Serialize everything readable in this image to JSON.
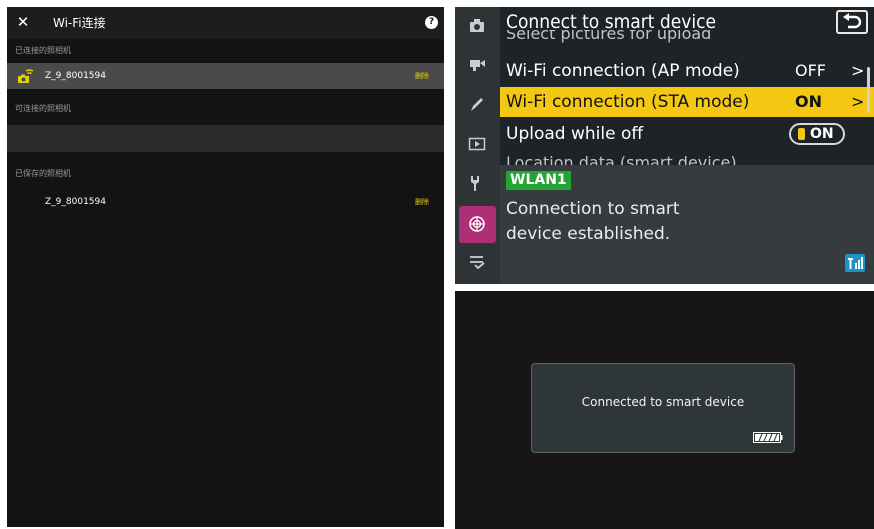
{
  "phone": {
    "close_icon": "close-icon",
    "title": "Wi-Fi连接",
    "help_icon": "help-icon",
    "section_connected": "已连接的照相机",
    "connected_camera": {
      "name": "Z_9_8001594",
      "delete_label": "删除",
      "icon": "camera-wifi-icon"
    },
    "section_available": "可连接的照相机",
    "section_saved": "已保存的照相机",
    "saved_camera": {
      "name": "Z_9_8001594",
      "delete_label": "删除"
    }
  },
  "camera_menu": {
    "title": "Connect to smart device",
    "partial_top": "Select pictures for upload",
    "items": [
      {
        "label": "Wi-Fi connection (AP mode)",
        "value": "OFF"
      },
      {
        "label": "Wi-Fi connection (STA mode)",
        "value": "ON"
      },
      {
        "label": "Upload while off",
        "value": "ON"
      }
    ],
    "partial_bottom": "Location data (smart device)",
    "wlan_badge": "WLAN1",
    "info_line1": "Connection to smart",
    "info_line2": "device established.",
    "sidebar_icons": [
      "photo-shooting-icon",
      "movie-icon",
      "pencil-icon",
      "playback-icon",
      "wrench-icon",
      "network-icon",
      "my-menu-icon"
    ],
    "accent_color": "#f4c713",
    "active_tab_color": "#ad3077"
  },
  "camera_screen": {
    "message": "Connected to smart device",
    "battery_icon": "battery-icon"
  }
}
